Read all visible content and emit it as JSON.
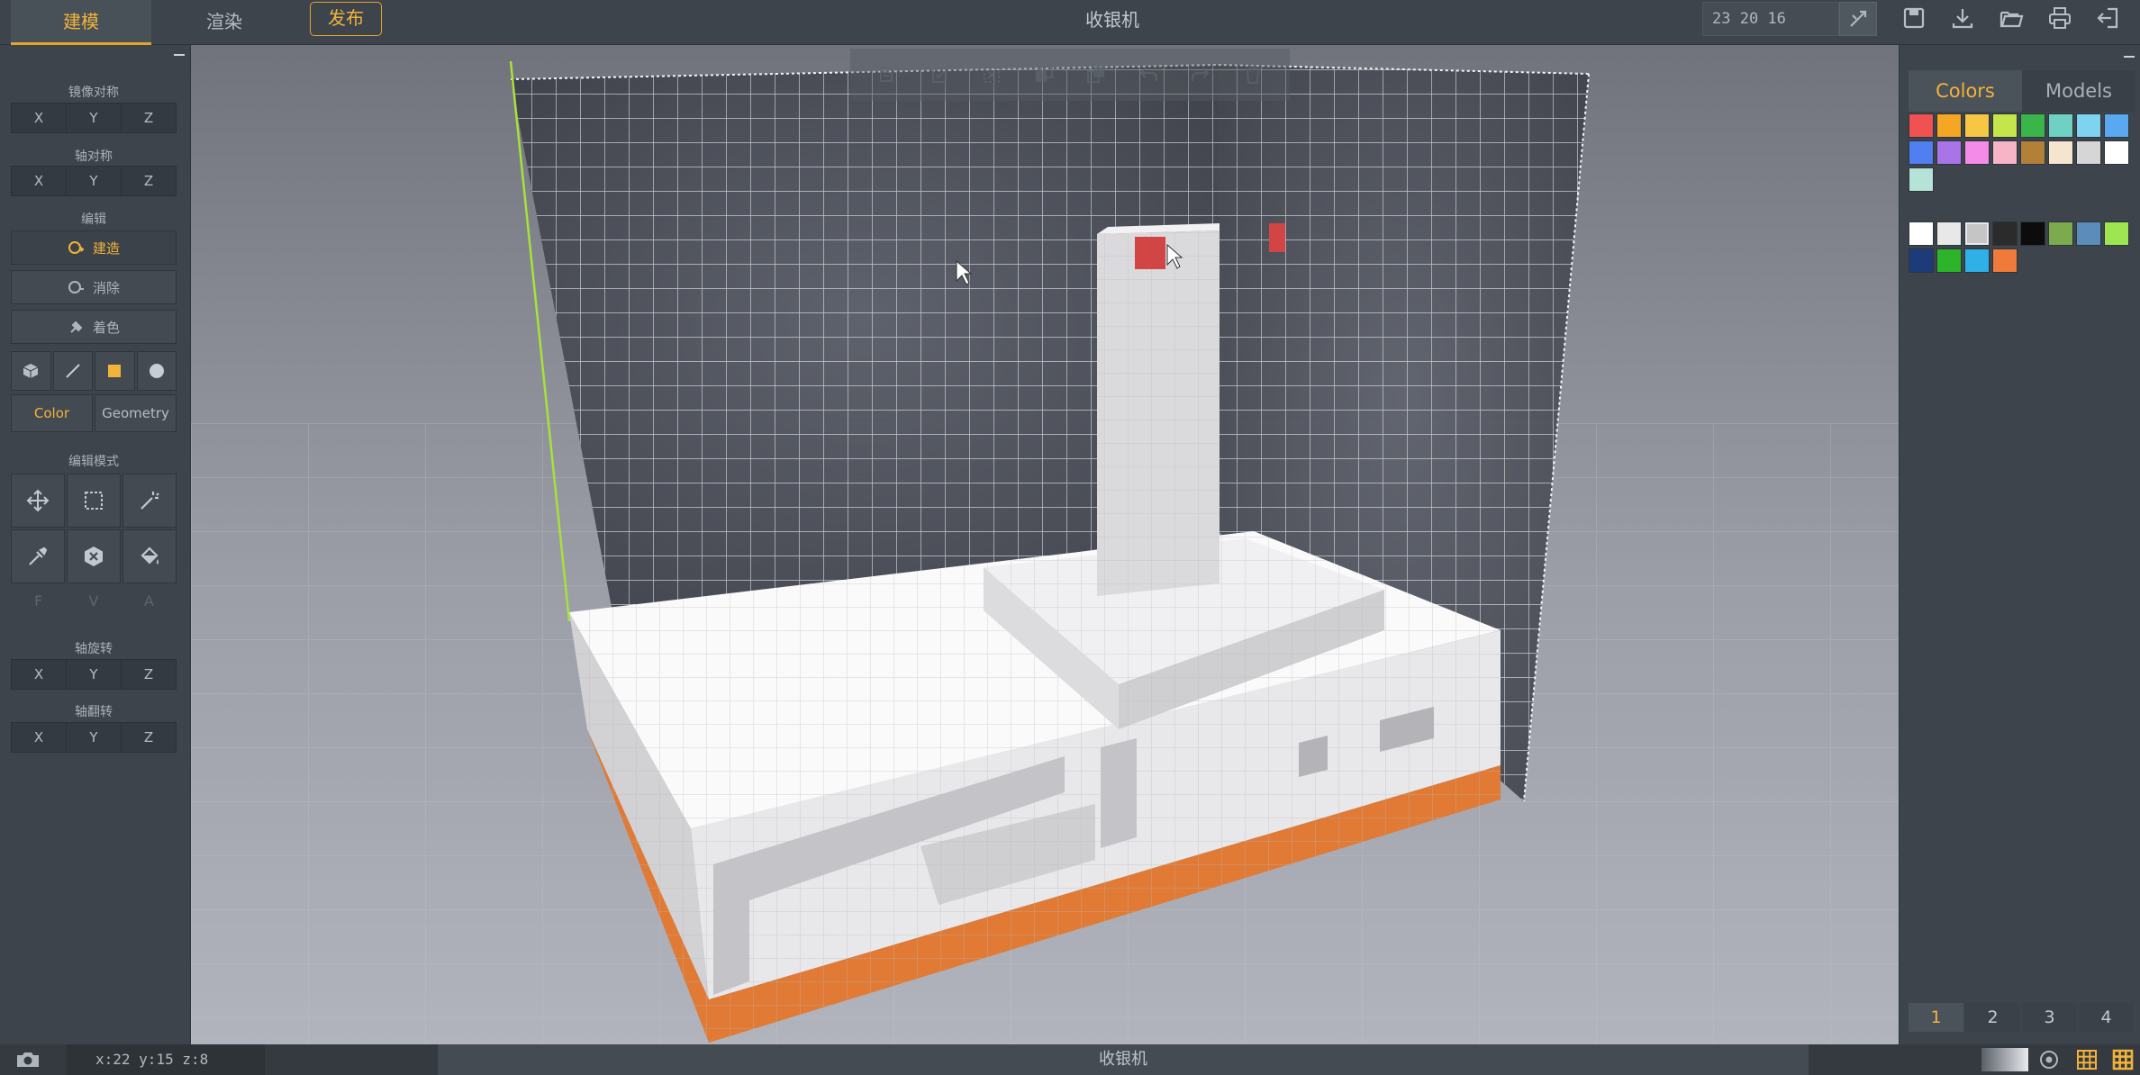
{
  "top_bar": {
    "tabs": [
      {
        "label": "建模",
        "active": true
      },
      {
        "label": "渲染",
        "active": false
      }
    ],
    "publish_label": "发布",
    "title": "收银机",
    "coordinates": "23 20 16",
    "icons": [
      "ruler-tool-icon",
      "save-icon",
      "download-icon",
      "open-folder-icon",
      "print-icon",
      "exit-icon"
    ]
  },
  "left_panel": {
    "camera_symmetry": {
      "label": "镜像对称",
      "axes": [
        "X",
        "Y",
        "Z"
      ]
    },
    "axis_symmetry": {
      "label": "轴对称",
      "axes": [
        "X",
        "Y",
        "Z"
      ]
    },
    "edit": {
      "label": "编辑",
      "build_label": "建造",
      "erase_label": "消除",
      "paint_label": "着色"
    },
    "shapes": [
      "cube-icon",
      "line-icon",
      "square-icon",
      "sphere-icon"
    ],
    "color_label": "Color",
    "geometry_label": "Geometry",
    "edit_mode": {
      "label": "编辑模式",
      "tools": [
        "move-icon",
        "select-box-icon",
        "magic-wand-icon",
        "eyedropper-icon",
        "clear-icon",
        "fill-bucket-icon"
      ]
    },
    "fva": [
      "F",
      "V",
      "A"
    ],
    "axis_rotate": {
      "label": "轴旋转",
      "axes": [
        "X",
        "Y",
        "Z"
      ]
    },
    "axis_flip": {
      "label": "轴翻转",
      "axes": [
        "X",
        "Y",
        "Z"
      ]
    }
  },
  "viewport": {
    "toolbar_icons": [
      "copy-icon",
      "paste-icon",
      "cut-icon",
      "duplicate-icon",
      "merge-icon",
      "undo-icon",
      "redo-icon",
      "delete-icon"
    ],
    "colors": {
      "top": "#ffffff",
      "front": "#eaeaea",
      "side": "#d4d4d4",
      "base": "#e07a35",
      "accent": "#d24545",
      "grid": "#f2f2f4"
    }
  },
  "right_panel": {
    "tabs": [
      {
        "label": "Colors",
        "active": true
      },
      {
        "label": "Models",
        "active": false
      }
    ],
    "palette_a": [
      "#f05252",
      "#f5a623",
      "#f6c744",
      "#c5e64a",
      "#3ab54a",
      "#6fd1c3",
      "#7ed3ef",
      "#58a9ef",
      "#4f7ff0",
      "#a874e8",
      "#f38be7",
      "#f6b4c6",
      "#b3803a",
      "#f5e5cf",
      "#d6d6d6",
      "#ffffff",
      "#b5e3d7"
    ],
    "palette_b": [
      "#ffffff",
      "#e8e8e8",
      "#c5c5c5",
      "#2b2b2b",
      "#0c0c0c",
      "#7bab4d",
      "#5a8db9",
      "#9de651",
      "#1d3a7a",
      "#2db42b",
      "#2fb0e6",
      "#f07a3a"
    ],
    "selected_swatch": 2,
    "pages": [
      "1",
      "2",
      "3",
      "4"
    ]
  },
  "status_bar": {
    "position": "x:22  y:15  z:8",
    "title": "收银机"
  }
}
